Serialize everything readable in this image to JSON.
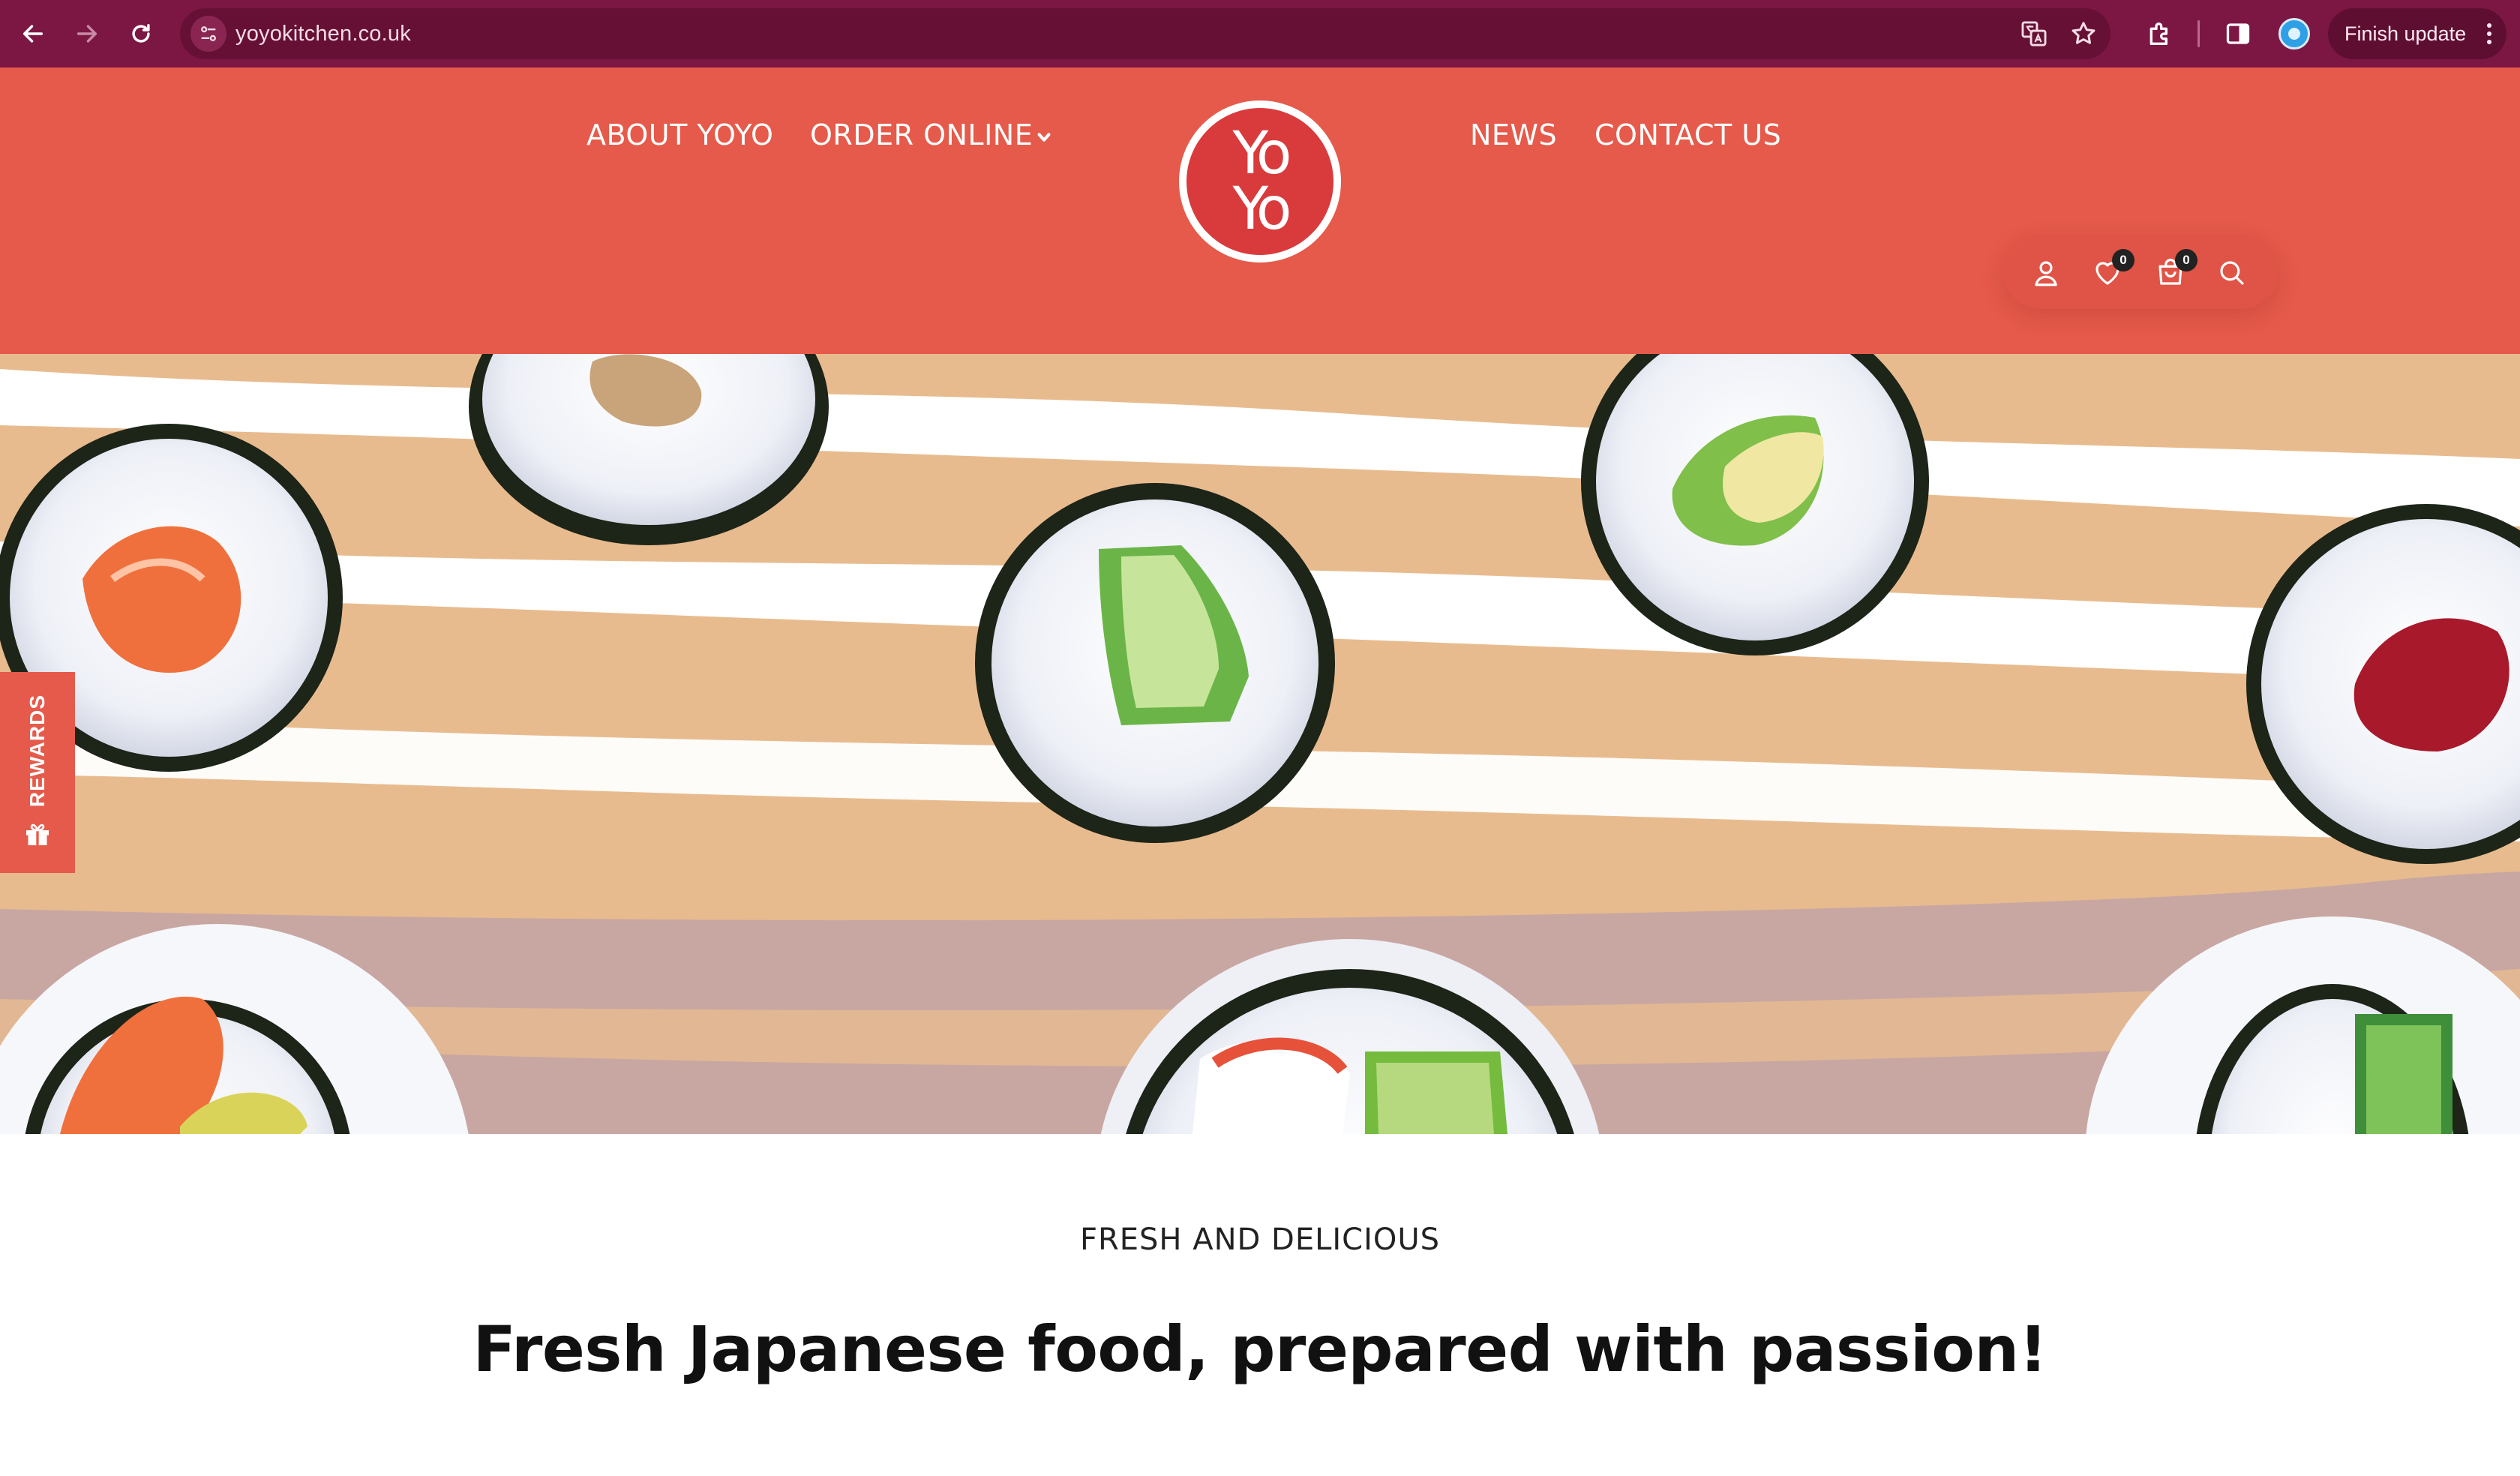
{
  "browser": {
    "url": "yoyokitchen.co.uk",
    "update_button": "Finish update",
    "icons": [
      "back-arrow-icon",
      "forward-arrow-icon",
      "reload-icon",
      "site-info-icon",
      "translate-icon",
      "star-icon",
      "extensions-icon",
      "side-panel-icon",
      "profile-icon",
      "more-vert-icon"
    ]
  },
  "header": {
    "nav_left": [
      "ABOUT YOYO",
      "ORDER ONLINE"
    ],
    "nav_right": [
      "NEWS",
      "CONTACT US"
    ],
    "logo_text": [
      "Yo",
      "Yo"
    ],
    "wishlist_count": "0",
    "cart_count": "0",
    "icons": [
      "user-icon",
      "heart-icon",
      "cart-icon",
      "search-icon"
    ],
    "background": "#e55a4a"
  },
  "rewards": {
    "label": "REWARDS"
  },
  "content": {
    "eyebrow": "FRESH AND DELICIOUS",
    "headline": "Fresh Japanese food, prepared with passion!"
  },
  "colors": {
    "browser_bar": "#7c1744",
    "brand_red": "#e55a4a",
    "logo_red": "#d93b3c"
  }
}
